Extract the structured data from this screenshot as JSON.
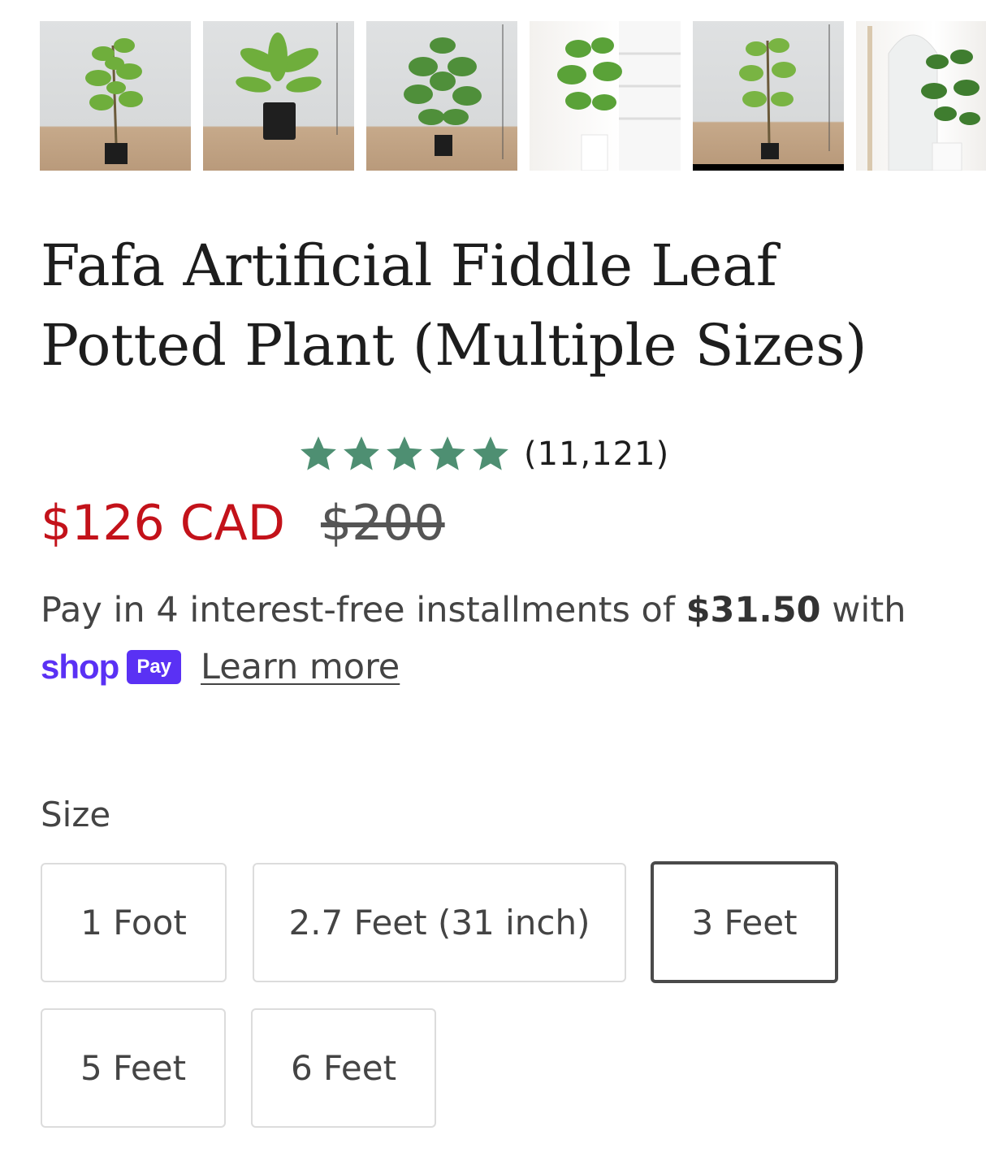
{
  "gallery": {
    "thumbnails": [
      {
        "icon": "fiddle-leaf-plant-photo-1"
      },
      {
        "icon": "fiddle-leaf-plant-photo-2"
      },
      {
        "icon": "fiddle-leaf-plant-photo-3"
      },
      {
        "icon": "fiddle-leaf-plant-photo-4"
      },
      {
        "icon": "fiddle-leaf-plant-photo-5"
      },
      {
        "icon": "fiddle-leaf-plant-photo-6"
      }
    ]
  },
  "product": {
    "title": "Fafa Artificial Fiddle Leaf Potted Plant (Multiple Sizes)",
    "rating_stars": 5,
    "review_count": "(11,121)",
    "price_sale": "$126 CAD",
    "price_original": "$200",
    "installments_text_before": "Pay in 4 interest-free installments of ",
    "installments_amount": "$31.50",
    "installments_text_after": " with",
    "shoppay_word": "shop",
    "shoppay_badge": "Pay",
    "learn_more": "Learn more"
  },
  "size": {
    "label": "Size",
    "options": [
      "1 Foot",
      "2.7 Feet (31 inch)",
      "3 Feet",
      "5 Feet",
      "6 Feet"
    ],
    "selected": "3 Feet"
  },
  "colors": {
    "star": "#4e8f72",
    "sale_price": "#c3121a",
    "shoppay": "#5a31f4"
  }
}
